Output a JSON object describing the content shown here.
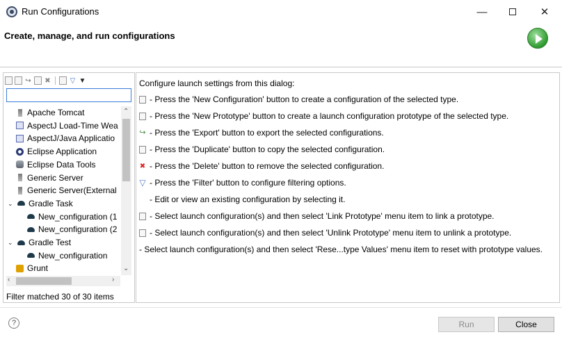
{
  "window": {
    "title": "Run Configurations"
  },
  "header": {
    "title": "Create, manage, and run configurations"
  },
  "left": {
    "filter_placeholder": "",
    "tree": [
      {
        "label": "Apache Tomcat",
        "icon": "server-icon",
        "level": 1
      },
      {
        "label": "AspectJ Load-Time Wea",
        "icon": "aspectj-icon",
        "level": 1
      },
      {
        "label": "AspectJ/Java Applicatio",
        "icon": "aspectj-icon",
        "level": 1
      },
      {
        "label": "Eclipse Application",
        "icon": "eclipse-icon",
        "level": 1
      },
      {
        "label": "Eclipse Data Tools",
        "icon": "database-icon",
        "level": 1
      },
      {
        "label": "Generic Server",
        "icon": "server-icon",
        "level": 1
      },
      {
        "label": "Generic Server(External I",
        "icon": "server-icon",
        "level": 1
      },
      {
        "label": "Gradle Task",
        "icon": "gradle-icon",
        "level": 0,
        "expanded": true
      },
      {
        "label": "New_configuration (1",
        "icon": "gradle-icon",
        "level": 2
      },
      {
        "label": "New_configuration (2",
        "icon": "gradle-icon",
        "level": 2
      },
      {
        "label": "Gradle Test",
        "icon": "gradle-icon",
        "level": 0,
        "expanded": true
      },
      {
        "label": "New_configuration",
        "icon": "gradle-icon",
        "level": 2
      },
      {
        "label": "Grunt",
        "icon": "grunt-icon",
        "level": 1
      }
    ],
    "status": "Filter matched 30 of 30 items"
  },
  "right": {
    "intro": "Configure launch settings from this dialog:",
    "lines": [
      {
        "icon": "new-config-icon",
        "text": "- Press the 'New Configuration' button to create a configuration of the selected type."
      },
      {
        "icon": "new-prototype-icon",
        "text": "- Press the 'New Prototype' button to create a launch configuration prototype of the selected type."
      },
      {
        "icon": "export-icon",
        "text": "- Press the 'Export' button to export the selected configurations."
      },
      {
        "icon": "duplicate-icon",
        "text": "- Press the 'Duplicate' button to copy the selected configuration."
      },
      {
        "icon": "delete-icon",
        "text": "- Press the 'Delete' button to remove the selected configuration."
      },
      {
        "icon": "filter-icon",
        "text": "- Press the 'Filter' button to configure filtering options."
      },
      {
        "icon": "",
        "text": "- Edit or view an existing configuration by selecting it."
      },
      {
        "icon": "link-prototype-icon",
        "text": "- Select launch configuration(s) and then select 'Link Prototype' menu item to link a prototype."
      },
      {
        "icon": "unlink-prototype-icon",
        "text": "- Select launch configuration(s) and then select 'Unlink Prototype' menu item to unlink a prototype."
      },
      {
        "icon": "",
        "text": "- Select launch configuration(s) and then select 'Rese...type Values' menu item to reset with prototype values."
      }
    ]
  },
  "footer": {
    "run_label": "Run",
    "close_label": "Close",
    "help_glyph": "?"
  }
}
